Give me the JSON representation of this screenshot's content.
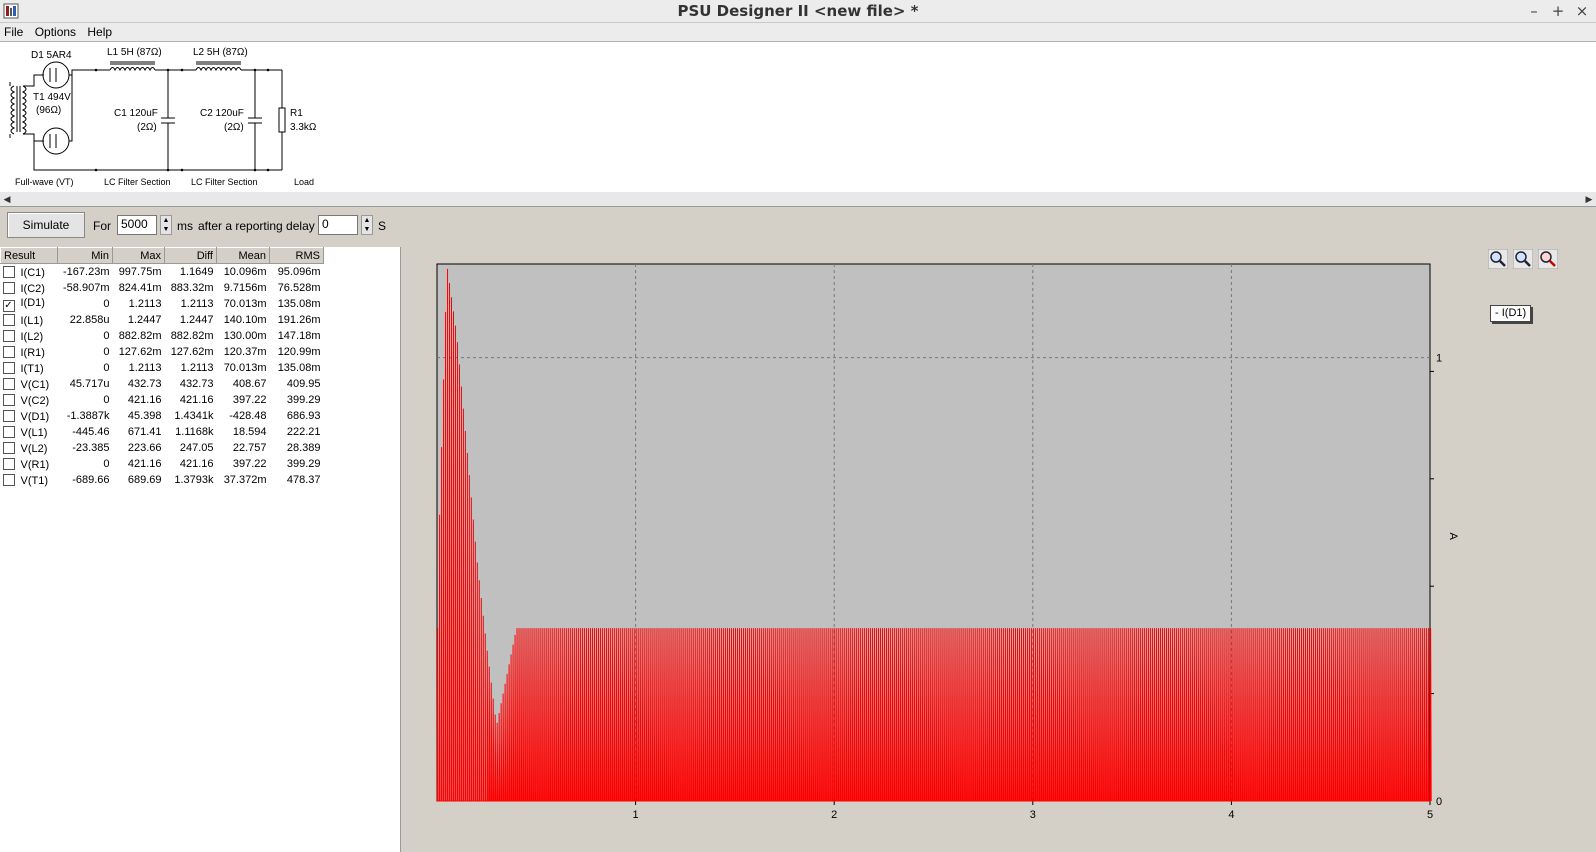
{
  "window": {
    "title": "PSU Designer II  <new file> *",
    "controls": [
      "–",
      "+",
      "×"
    ]
  },
  "menu": [
    "File",
    "Options",
    "Help"
  ],
  "schematic": {
    "d1": "D1 5AR4",
    "l1": "L1 5H (87Ω)",
    "l2": "L2 5H (87Ω)",
    "t1": "T1 494V",
    "t1_r": "(96Ω)",
    "c1": "C1 120uF",
    "c1_r": "(2Ω)",
    "c2": "C2 120uF",
    "c2_r": "(2Ω)",
    "r1": "R1",
    "r1_v": "3.3kΩ",
    "sections": [
      "Full-wave (VT)",
      "LC Filter Section",
      "LC Filter Section",
      "Load"
    ]
  },
  "sim": {
    "button": "Simulate",
    "for_label": "For",
    "duration": "5000",
    "ms": "ms",
    "delay_label": "after a reporting delay of",
    "delay": "0",
    "s": "S"
  },
  "table": {
    "headers": [
      "Result",
      "Min",
      "Max",
      "Diff",
      "Mean",
      "RMS"
    ],
    "rows": [
      {
        "name": "I(C1)",
        "checked": false,
        "min": "-167.23m",
        "max": "997.75m",
        "diff": "1.1649",
        "mean": "10.096m",
        "rms": "95.096m"
      },
      {
        "name": "I(C2)",
        "checked": false,
        "min": "-58.907m",
        "max": "824.41m",
        "diff": "883.32m",
        "mean": "9.7156m",
        "rms": "76.528m"
      },
      {
        "name": "I(D1)",
        "checked": true,
        "min": "0",
        "max": "1.2113",
        "diff": "1.2113",
        "mean": "70.013m",
        "rms": "135.08m"
      },
      {
        "name": "I(L1)",
        "checked": false,
        "min": "22.858u",
        "max": "1.2447",
        "diff": "1.2447",
        "mean": "140.10m",
        "rms": "191.26m"
      },
      {
        "name": "I(L2)",
        "checked": false,
        "min": "0",
        "max": "882.82m",
        "diff": "882.82m",
        "mean": "130.00m",
        "rms": "147.18m"
      },
      {
        "name": "I(R1)",
        "checked": false,
        "min": "0",
        "max": "127.62m",
        "diff": "127.62m",
        "mean": "120.37m",
        "rms": "120.99m"
      },
      {
        "name": "I(T1)",
        "checked": false,
        "min": "0",
        "max": "1.2113",
        "diff": "1.2113",
        "mean": "70.013m",
        "rms": "135.08m"
      },
      {
        "name": "V(C1)",
        "checked": false,
        "min": "45.717u",
        "max": "432.73",
        "diff": "432.73",
        "mean": "408.67",
        "rms": "409.95"
      },
      {
        "name": "V(C2)",
        "checked": false,
        "min": "0",
        "max": "421.16",
        "diff": "421.16",
        "mean": "397.22",
        "rms": "399.29"
      },
      {
        "name": "V(D1)",
        "checked": false,
        "min": "-1.3887k",
        "max": "45.398",
        "diff": "1.4341k",
        "mean": "-428.48",
        "rms": "686.93"
      },
      {
        "name": "V(L1)",
        "checked": false,
        "min": "-445.46",
        "max": "671.41",
        "diff": "1.1168k",
        "mean": "18.594",
        "rms": "222.21"
      },
      {
        "name": "V(L2)",
        "checked": false,
        "min": "-23.385",
        "max": "223.66",
        "diff": "247.05",
        "mean": "22.757",
        "rms": "28.389"
      },
      {
        "name": "V(R1)",
        "checked": false,
        "min": "0",
        "max": "421.16",
        "diff": "421.16",
        "mean": "397.22",
        "rms": "399.29"
      },
      {
        "name": "V(T1)",
        "checked": false,
        "min": "-689.66",
        "max": "689.69",
        "diff": "1.3793k",
        "mean": "37.372m",
        "rms": "478.37"
      }
    ]
  },
  "colors": {
    "trace": "#ff0000",
    "plot_bg": "#c0c0c0",
    "accent": "#2a5db0"
  },
  "icons": [
    "zoom-in-icon",
    "zoom-out-icon",
    "zoom-reset-icon"
  ],
  "chart_data": {
    "type": "line",
    "legend": "- I(D1)",
    "legend_position": "top-right",
    "ylabel": "A",
    "xlim": [
      0,
      5
    ],
    "ylim": [
      0,
      1.2113
    ],
    "x_ticks": [
      "1",
      "2",
      "3",
      "4",
      "5"
    ],
    "y_ticks": [
      "0",
      "1"
    ],
    "grid": true,
    "series": [
      {
        "name": "I(D1)",
        "description": "rectifier pulses; initial surge ~1.21 A decaying to steady ~0.39 A peaks",
        "peaks_x": [
          0.01,
          0.05,
          0.1,
          0.15,
          0.2,
          0.25,
          0.3,
          0.4,
          1,
          2,
          3,
          4,
          5
        ],
        "peaks_y": [
          0.6,
          1.21,
          1.05,
          0.8,
          0.55,
          0.35,
          0.17,
          0.39,
          0.39,
          0.39,
          0.39,
          0.39,
          0.39
        ]
      }
    ]
  }
}
